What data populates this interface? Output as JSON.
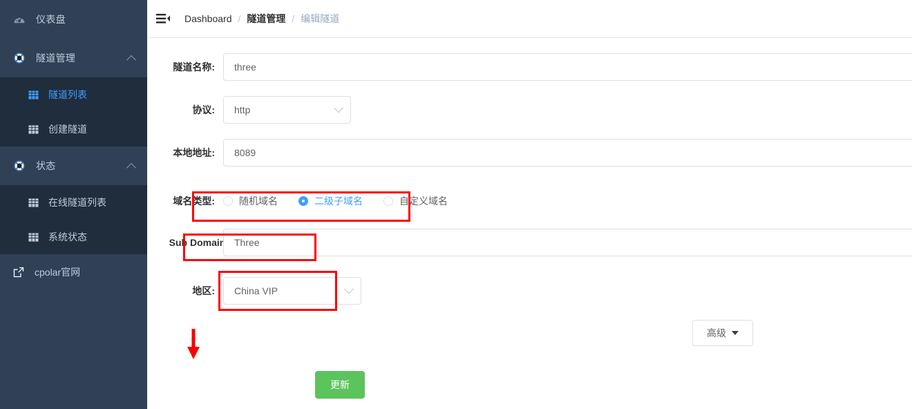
{
  "sidebar": {
    "items": [
      {
        "label": "仪表盘",
        "icon": "dashboard-gauge-icon",
        "type": "menu",
        "expandable": false
      },
      {
        "label": "隧道管理",
        "icon": "lifebuoy-icon",
        "type": "menu",
        "expandable": true
      },
      {
        "label": "隧道列表",
        "icon": "grid-table-icon",
        "type": "submenu",
        "active": true
      },
      {
        "label": "创建隧道",
        "icon": "grid-table-icon",
        "type": "submenu",
        "active": false
      },
      {
        "label": "状态",
        "icon": "lifebuoy-icon",
        "type": "menu",
        "expandable": true
      },
      {
        "label": "在线隧道列表",
        "icon": "grid-table-icon",
        "type": "submenu",
        "active": false
      },
      {
        "label": "系统状态",
        "icon": "grid-table-icon",
        "type": "submenu",
        "active": false
      },
      {
        "label": "cpolar官网",
        "icon": "external-link-icon",
        "type": "link"
      }
    ],
    "colors": {
      "background": "#304156",
      "submenu_background": "#1f2d3d",
      "text": "#bfcbd9",
      "active_text": "#409eff"
    }
  },
  "navbar": {
    "hamburger_icon": "hamburger-fold-icon",
    "breadcrumb": [
      {
        "label": "Dashboard",
        "current": false
      },
      {
        "label": "隧道管理",
        "current": false
      },
      {
        "label": "编辑隧道",
        "current": true
      }
    ],
    "separator": "/"
  },
  "form": {
    "tunnel_name": {
      "label": "隧道名称:",
      "value": "three",
      "placeholder": ""
    },
    "protocol": {
      "label": "协议:",
      "value": "http",
      "caret_icon": "chevron-down-icon"
    },
    "local_address": {
      "label": "本地地址:",
      "value": "8089",
      "placeholder": ""
    },
    "domain_type": {
      "label": "域名类型:",
      "options": [
        {
          "label": "随机域名",
          "checked": false
        },
        {
          "label": "二级子域名",
          "checked": true
        },
        {
          "label": "自定义域名",
          "checked": false
        }
      ]
    },
    "sub_domain": {
      "label": "Sub Domain:",
      "value": "Three",
      "placeholder": ""
    },
    "region": {
      "label": "地区:",
      "value": "China VIP",
      "caret_icon": "chevron-down-icon"
    },
    "advanced_button": {
      "label": "高级",
      "icon": "triangle-down-icon"
    },
    "submit_button": {
      "label": "更新",
      "color": "#5cc45c"
    }
  },
  "annotations": {
    "highlight_color": "#fb0000",
    "boxes": [
      {
        "name": "domain-type-highlight"
      },
      {
        "name": "sub-domain-highlight"
      },
      {
        "name": "region-highlight"
      }
    ],
    "arrow": {
      "name": "update-button-arrow",
      "direction": "down"
    }
  }
}
